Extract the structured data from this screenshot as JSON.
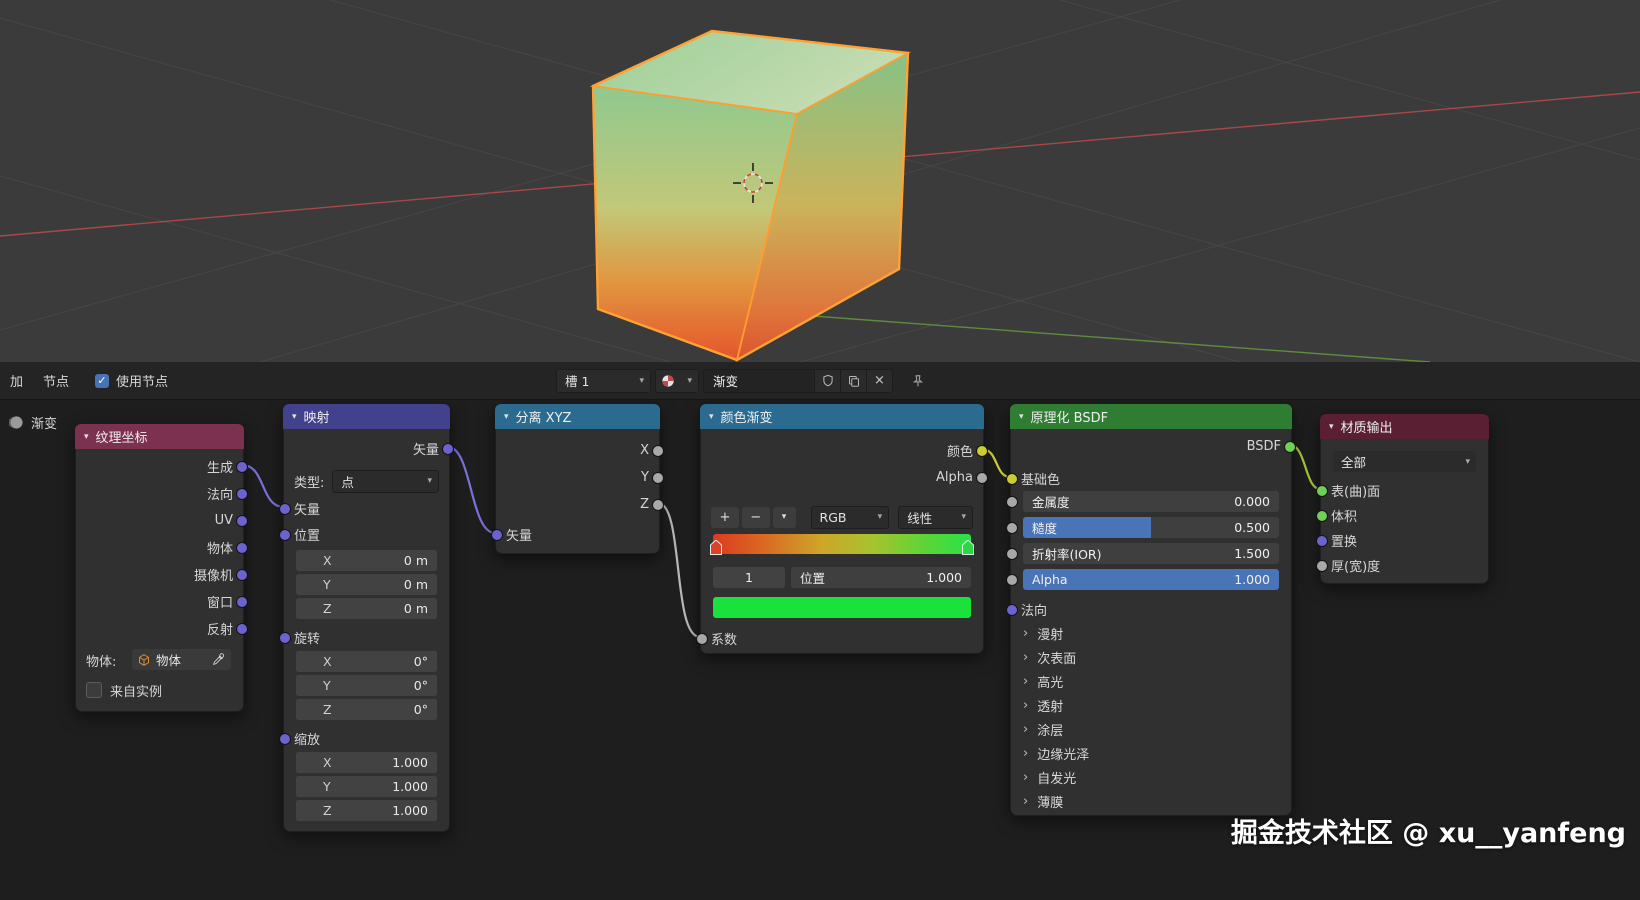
{
  "header_bar": {
    "menu_add": "加",
    "menu_node": "节点",
    "use_nodes_label": "使用节点",
    "use_nodes_check": "✓",
    "slot_value": "槽 1",
    "material_name": "渐变",
    "close_label": "×"
  },
  "editor_label": "渐变",
  "watermark": "掘金技术社区 @ xu__yanfeng",
  "nodes": {
    "texcoord": {
      "title": "纹理坐标",
      "outputs": [
        "生成",
        "法向",
        "UV",
        "物体",
        "摄像机",
        "窗口",
        "反射"
      ],
      "object_label": "物体:",
      "object_value": "物体",
      "from_instancer_label": "来自实例"
    },
    "mapping": {
      "title": "映射",
      "vector_out": "矢量",
      "type_label": "类型:",
      "type_value": "点",
      "vector_in": "矢量",
      "location_label": "位置",
      "rotation_label": "旋转",
      "scale_label": "缩放",
      "location": [
        {
          "axis": "X",
          "value": "0 m"
        },
        {
          "axis": "Y",
          "value": "0 m"
        },
        {
          "axis": "Z",
          "value": "0 m"
        }
      ],
      "rotation": [
        {
          "axis": "X",
          "value": "0°"
        },
        {
          "axis": "Y",
          "value": "0°"
        },
        {
          "axis": "Z",
          "value": "0°"
        }
      ],
      "scale": [
        {
          "axis": "X",
          "value": "1.000"
        },
        {
          "axis": "Y",
          "value": "1.000"
        },
        {
          "axis": "Z",
          "value": "1.000"
        }
      ]
    },
    "separate_xyz": {
      "title": "分离 XYZ",
      "outputs": [
        "X",
        "Y",
        "Z"
      ],
      "vector_in": "矢量"
    },
    "color_ramp": {
      "title": "颜色渐变",
      "color_out": "颜色",
      "alpha_out": "Alpha",
      "add_label": "+",
      "remove_label": "−",
      "color_mode": "RGB",
      "interpolation": "线性",
      "active_index": "1",
      "position_label": "位置",
      "position_value": "1.000",
      "fac_in": "系数",
      "active_color": "#1ae23c"
    },
    "principled": {
      "title": "原理化 BSDF",
      "output": "BSDF",
      "base_color_label": "基础色",
      "sliders": [
        {
          "label": "金属度",
          "value": "0.000"
        },
        {
          "label": "糙度",
          "value": "0.500"
        },
        {
          "label": "折射率(IOR)",
          "value": "1.500"
        },
        {
          "label": "Alpha",
          "value": "1.000"
        }
      ],
      "normal_label": "法向",
      "sections": [
        "漫射",
        "次表面",
        "高光",
        "透射",
        "涂层",
        "边缘光泽",
        "自发光",
        "薄膜"
      ]
    },
    "material_output": {
      "title": "材质输出",
      "target_value": "全部",
      "inputs": [
        "表(曲)面",
        "体积",
        "置换",
        "厚(宽)度"
      ]
    }
  }
}
